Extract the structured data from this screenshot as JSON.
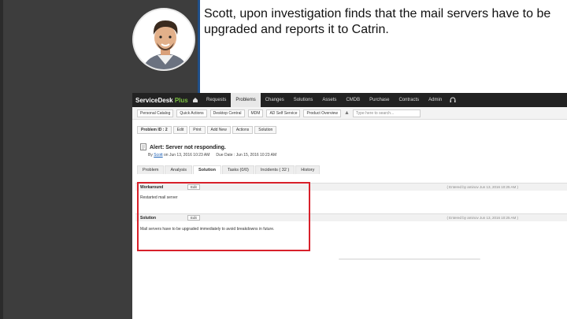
{
  "caption": "Scott, upon investigation finds that the mail servers have to be upgraded and reports it to Catrin.",
  "app": {
    "brand_main": "ServiceDesk",
    "brand_plus": "Plus",
    "nav": [
      "Requests",
      "Problems",
      "Changes",
      "Solutions",
      "Assets",
      "CMDB",
      "Purchase",
      "Contracts",
      "Admin"
    ],
    "active_nav": "Problems"
  },
  "toolbar": {
    "items": [
      "Personal Catalog",
      "Quick Actions",
      "Desktop Central",
      "MDM",
      "AD Self Service",
      "Product Overview"
    ],
    "search_placeholder": "Type here to search..."
  },
  "problem": {
    "id_label": "Problem ID : 2",
    "buttons": [
      "Edit",
      "Print",
      "Add New",
      "Actions",
      "Solution"
    ],
    "title": "Alert: Server not responding.",
    "by_label": "By",
    "by_user": "Scott",
    "on_date": "on Jun 13, 2016 10:23 AM",
    "due_date": "Due Date : Jun 15, 2016 10:23 AM"
  },
  "tabs": [
    "Problem",
    "Analysis",
    "Solution",
    "Tasks (0/0)",
    "Incidents ( 32 )",
    "History"
  ],
  "active_tab": "Solution",
  "sections": [
    {
      "label": "Workaround",
      "edit": "Edit",
      "entered": "( Entered by aminov Jun 13, 2016 10:25 AM )",
      "text": "Restarted mail server"
    },
    {
      "label": "Solution",
      "edit": "Edit",
      "entered": "( Entered by aminov Jun 13, 2016 10:25 AM )",
      "text": "Mail servers have to be upgraded immediately to avoid breakdowns in future."
    }
  ],
  "colors": {
    "highlight": "#d8202a",
    "brand_plus": "#7cc242",
    "dark_bg": "#3d3d3d"
  }
}
